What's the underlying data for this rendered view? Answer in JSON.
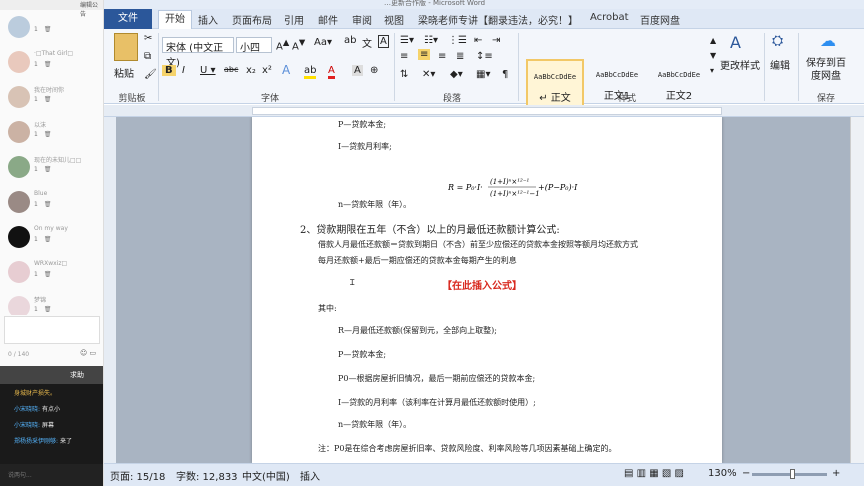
{
  "left_panel": {
    "top_label": "编辑公告",
    "chat_items": [
      {
        "name": "",
        "count": "1"
      },
      {
        "name": "·□That Girl□",
        "count": "1"
      },
      {
        "name": "我在时间你",
        "count": "1"
      },
      {
        "name": "以沫",
        "count": "1"
      },
      {
        "name": "现在的未知儿□□",
        "count": "1"
      },
      {
        "name": "Blue",
        "count": "1"
      },
      {
        "name": "On my way",
        "count": "1"
      },
      {
        "name": "WRXwxiz□",
        "count": "1"
      },
      {
        "name": "梦锦",
        "count": "1"
      }
    ],
    "char_count": "0 / 140",
    "help_label": "求助",
    "messages": [
      {
        "who": "身城财产损失。",
        "text": ""
      },
      {
        "who": "小宋晓晓:",
        "text": "有点小"
      },
      {
        "who": "小宋晓晓:",
        "text": "屏幕"
      },
      {
        "who": "郑杨扬采伊刚够:",
        "text": "来了"
      }
    ],
    "say_placeholder": "说两句..."
  },
  "word": {
    "title_partial": "…更新合作版 - Microsoft Word",
    "tabs": [
      "文件",
      "开始",
      "插入",
      "页面布局",
      "引用",
      "邮件",
      "审阅",
      "视图",
      "梁晓老师专讲【翻录违法，必究！】",
      "Acrobat",
      "百度网盘"
    ],
    "ribbon": {
      "paste": "粘贴",
      "clipboard_group": "剪贴板",
      "font_name": "宋体 (中文正文)",
      "font_size": "小四",
      "font_group": "字体",
      "paragraph_group": "段落",
      "styles_group": "样式",
      "styles": [
        {
          "sample": "AaBbCcDdEe",
          "name": "↵ 正文"
        },
        {
          "sample": "AaBbCcDdEe",
          "name": "正文1"
        },
        {
          "sample": "AaBbCcDdEe",
          "name": "正文2"
        }
      ],
      "change_styles": "更改样式",
      "edit_label": "编辑",
      "save_baidu": "保存到百度网盘",
      "save_group": "保存"
    },
    "document": {
      "lines": [
        "P—贷款本金;",
        "I—贷款月利率;",
        "n—贷款年限（年）。",
        "2、贷款期限在五年（不含）以上的月最低还款额计算公式:",
        "借款人月最低还款额＝贷款到期日（不含）前至少应偿还的贷款本金按照等额月均还款方式",
        "每月还款额+最后一期应偿还的贷款本金每期产生的利息",
        "【在此插入公式】",
        "其中:",
        "R—月最低还款额(保留到元，全部向上取整);",
        "P—贷款本金;",
        "P0—根据房屋折旧情况，最后一期前应偿还的贷款本金;",
        "I—贷款的月利率（该利率在计算月最低还款额时使用）;",
        "n—贷款年限（年）。",
        "注：P0是在综合考虑房屋折旧率、贷款风险度、利率风险等几项因素基础上确定的。"
      ],
      "formula": "R = P₀·I·(1+I)^(n×12−1)/((1+I)^(n×12−1)−1) + (P − P₀)·I"
    },
    "status": {
      "page": "页面: 15/18",
      "words": "字数: 12,833",
      "lang": "中文(中国)",
      "mode": "插入",
      "zoom": "130%"
    }
  }
}
